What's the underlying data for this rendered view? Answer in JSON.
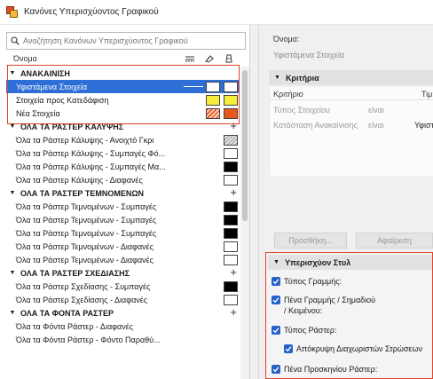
{
  "window": {
    "title": "Κανόνες Υπερισχύοντος Γραφικού"
  },
  "search": {
    "placeholder": "Αναζήτηση Κανόνων Υπερισχύοντος Γραφικού"
  },
  "list_header": {
    "name_col": "Όνομα",
    "icons": [
      "line-type-icon",
      "fill-pen-icon",
      "fill-background-icon"
    ]
  },
  "groups": [
    {
      "label": "ΑΝΑΚΑΙΝΙΣΗ",
      "rows": [
        {
          "label": "Υφιστάμενα Στοιχεία",
          "selected": true,
          "sw1": "#ffffff",
          "sw2": "#ffffff"
        },
        {
          "label": "Στοιχεία προς Κατεδάφιση",
          "sw1": "#f5ef3c",
          "sw2": "#f5ef3c"
        },
        {
          "label": "Νέα Στοιχεία",
          "sw1": "hatch-red",
          "sw2": "#e8571c"
        }
      ]
    },
    {
      "label": "ΟΛΑ ΤΑ ΡΑΣΤΕΡ ΚΑΛΥΨΗΣ",
      "rows": [
        {
          "label": "Όλα τα Ράστερ Κάλυψης - Ανοιχτό Γκρι",
          "sw2": "hatch-gray"
        },
        {
          "label": "Όλα τα Ράστερ Κάλυψης - Συμπαγές Φό...",
          "sw2": "#ffffff"
        },
        {
          "label": "Όλα τα Ράστερ Κάλυψης - Συμπαγές Μα...",
          "sw2": "#000000"
        },
        {
          "label": "Όλα τα Ράστερ Κάλυψης - Διαφανές",
          "sw2": "#ffffff"
        }
      ]
    },
    {
      "label": "ΟΛΑ ΤΑ ΡΑΣΤΕΡ ΤΕΜΝΟΜΕΝΩΝ",
      "rows": [
        {
          "label": "Όλα τα Ράστερ Τεμνομένων - Συμπαγές",
          "sw2": "#000000"
        },
        {
          "label": "Όλα τα Ράστερ Τεμνομένων - Συμπαγές",
          "sw2": "#000000"
        },
        {
          "label": "Όλα τα Ράστερ Τεμνομένων - Συμπαγές",
          "sw2": "#000000"
        },
        {
          "label": "Όλα τα Ράστερ Τεμνομένων - Διαφανές",
          "sw2": "#ffffff"
        },
        {
          "label": "Όλα τα Ράστερ Τεμνομένων - Διαφανές",
          "sw2": "#ffffff"
        }
      ]
    },
    {
      "label": "ΟΛΑ ΤΑ ΡΑΣΤΕΡ ΣΧΕΔΙΑΣΗΣ",
      "rows": [
        {
          "label": "Όλα τα Ράστερ Σχεδίασης - Συμπαγές",
          "sw2": "#000000"
        },
        {
          "label": "Όλα τα Ράστερ Σχεδίασης - Διαφανές",
          "sw2": "#ffffff"
        }
      ]
    },
    {
      "label": "ΟΛΑ ΤΑ ΦΟΝΤΑ ΡΑΣΤΕΡ",
      "rows": [
        {
          "label": "Όλα τα Φόντα Ράστερ - Διαφανές"
        },
        {
          "label": "Όλα τα Φόντα Ράστερ - Φόντο Παραθύ..."
        }
      ]
    }
  ],
  "right": {
    "name_label": "Όνομα:",
    "name_value": "Υφιστάμενα Στοιχεία",
    "criteria_header": "Κριτήρια",
    "crit_col1": "Κριτήριο",
    "crit_col2": "Τιμή",
    "crit_rows": [
      {
        "criterion": "Τύπος Στοιχείου",
        "op": "είναι",
        "value": ""
      },
      {
        "criterion": "Κατάσταση Ανακαίνισης",
        "op": "είναι",
        "value": "Υφιστά"
      }
    ],
    "add_button": "Προσθήκη...",
    "remove_button": "Αφαίρεση",
    "styles_header": "Υπερισχύον Στυλ",
    "checks": [
      {
        "label": "Τύπος Γραμμής:",
        "checked": true
      },
      {
        "label": "Πένα Γραμμής / Σημαδιού / Κειμένου:",
        "checked": true
      },
      {
        "label": "Τύπος Ράστερ:",
        "checked": true
      },
      {
        "label": "Απόκρυψη Διαχωριστών Στρώσεων",
        "checked": true
      },
      {
        "label": "Πένα Προσκηνίου Ράστερ:",
        "checked": true
      }
    ]
  }
}
